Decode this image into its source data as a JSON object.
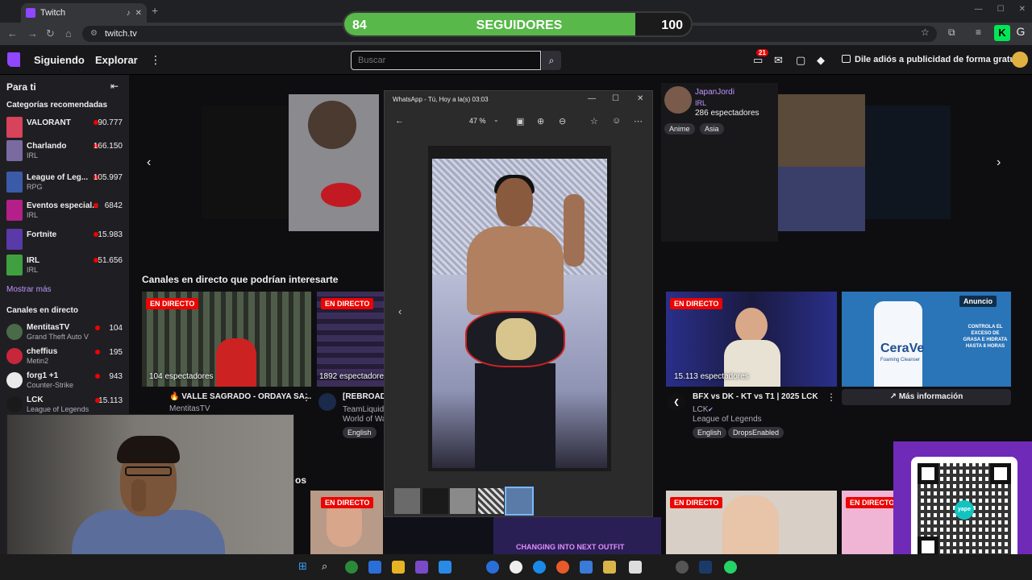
{
  "browser": {
    "tab_title": "Twitch",
    "url": "twitch.tv",
    "profile_initial": "G",
    "extension_label": "K"
  },
  "follower_goal": {
    "current": "84",
    "label": "SEGUIDORES",
    "target": "100",
    "progress": 0.84,
    "fill_color": "#58b84a"
  },
  "twitch": {
    "nav": {
      "following": "Siguiendo",
      "browse": "Explorar"
    },
    "search_placeholder": "Buscar",
    "notifications_count": "21",
    "promo": "Dile adiós a publicidad de forma gratuita",
    "brand_color": "#9146ff"
  },
  "sidebar": {
    "title": "Para ti",
    "recommended_title": "Categorías recomendadas",
    "categories": [
      {
        "name": "VALORANT",
        "sub": "",
        "count": "90.777",
        "color": "#d6435a"
      },
      {
        "name": "Charlando",
        "sub": "IRL",
        "count": "166.150",
        "color": "#7a6aa0"
      },
      {
        "name": "League of Leg...",
        "sub": "RPG",
        "count": "105.997",
        "color": "#3b5ba8"
      },
      {
        "name": "Eventos especial...",
        "sub": "IRL",
        "count": "6842",
        "color": "#b41f8a"
      },
      {
        "name": "Fortnite",
        "sub": "",
        "count": "15.983",
        "color": "#5a3aa8"
      },
      {
        "name": "IRL",
        "sub": "IRL",
        "count": "51.656",
        "color": "#40a040"
      }
    ],
    "show_more": "Mostrar más",
    "live_title": "Canales en directo",
    "channels": [
      {
        "name": "MentitasTV",
        "game": "Grand Theft Auto V",
        "count": "104",
        "color": "#4a6a4a"
      },
      {
        "name": "cheffius",
        "game": "Metin2",
        "count": "195",
        "color": "#c8263a"
      },
      {
        "name": "forg1 +1",
        "game": "Counter-Strike",
        "count": "943",
        "color": "#eaeaea"
      },
      {
        "name": "LCK",
        "game": "League of Legends",
        "count": "15.113",
        "color": "#1a1a1a"
      }
    ]
  },
  "carousel": {
    "featured_channel": "JapanJordi",
    "featured_category": "IRL",
    "featured_viewers": "286 espectadores",
    "featured_tags": [
      "Anime",
      "Asia"
    ]
  },
  "recommended_section": {
    "title": "Canales en directo que podrían interesarte",
    "live_label": "EN DIRECTO",
    "cards": [
      {
        "viewers": "104 espectadores",
        "title": "🔥 VALLE SAGRADO - ORDAYA SA...",
        "channel": "MentitasTV"
      },
      {
        "viewers": "1892 espectadores",
        "title": "[REBROADC",
        "channel": "TeamLiquid",
        "category": "World of Wa",
        "tags": [
          "English"
        ]
      },
      {
        "viewers": "15.113 espectadores",
        "title": "BFX vs DK - KT vs T1 | 2025 LCK",
        "channel": "LCK",
        "category": "League of Legends",
        "tags": [
          "English",
          "DropsEnabled"
        ]
      }
    ],
    "ad": {
      "badge": "Anuncio",
      "brand": "CeraVe",
      "product": "Foaming Cleanser",
      "copy": "CONTROLA EL EXCESO DE GRASA E HIDRATA HASTA 8 HORAS",
      "cta": "Más información"
    }
  },
  "bottom_section": {
    "label_fragment": "os",
    "outfit_label": "CHANGING INTO NEXT OUTFIT"
  },
  "viewer": {
    "title": "WhatsApp - Tú, Hoy a la(s) 03:03",
    "zoom": "47 %"
  },
  "qr": {
    "logo_text": "yape"
  }
}
